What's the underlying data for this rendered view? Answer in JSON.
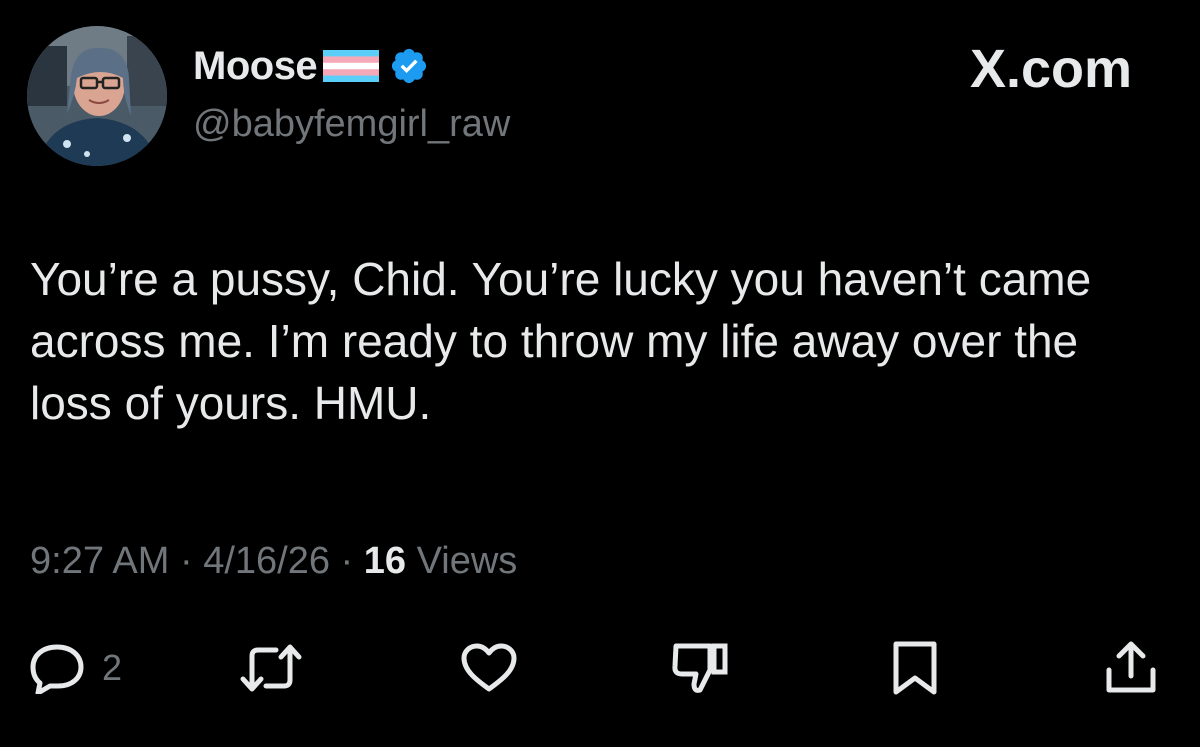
{
  "tweet": {
    "author": {
      "display_name": "Moose",
      "handle": "@babyfemgirl_raw",
      "flag_icon": "transgender-flag-icon",
      "verified_icon": "verified-badge-icon",
      "verified_color": "#1d9bf0"
    },
    "site_label": "X.com",
    "text": "You’re a pussy, Chid. You’re lucky you haven’t came across me. I’m ready to throw my life away over the loss of yours. HMU.",
    "time": "9:27 AM",
    "separator": " · ",
    "date": "4/16/26",
    "views_count": "16",
    "views_label": " Views",
    "actions": {
      "reply": {
        "icon": "reply-icon",
        "count": "2"
      },
      "repost": {
        "icon": "repost-icon"
      },
      "like": {
        "icon": "heart-icon"
      },
      "dislike": {
        "icon": "thumbs-down-icon"
      },
      "bookmark": {
        "icon": "bookmark-icon"
      },
      "share": {
        "icon": "share-icon"
      }
    }
  },
  "colors": {
    "background": "#000000",
    "text_primary": "#e7e9ea",
    "text_secondary": "#71767b",
    "accent": "#1d9bf0"
  }
}
